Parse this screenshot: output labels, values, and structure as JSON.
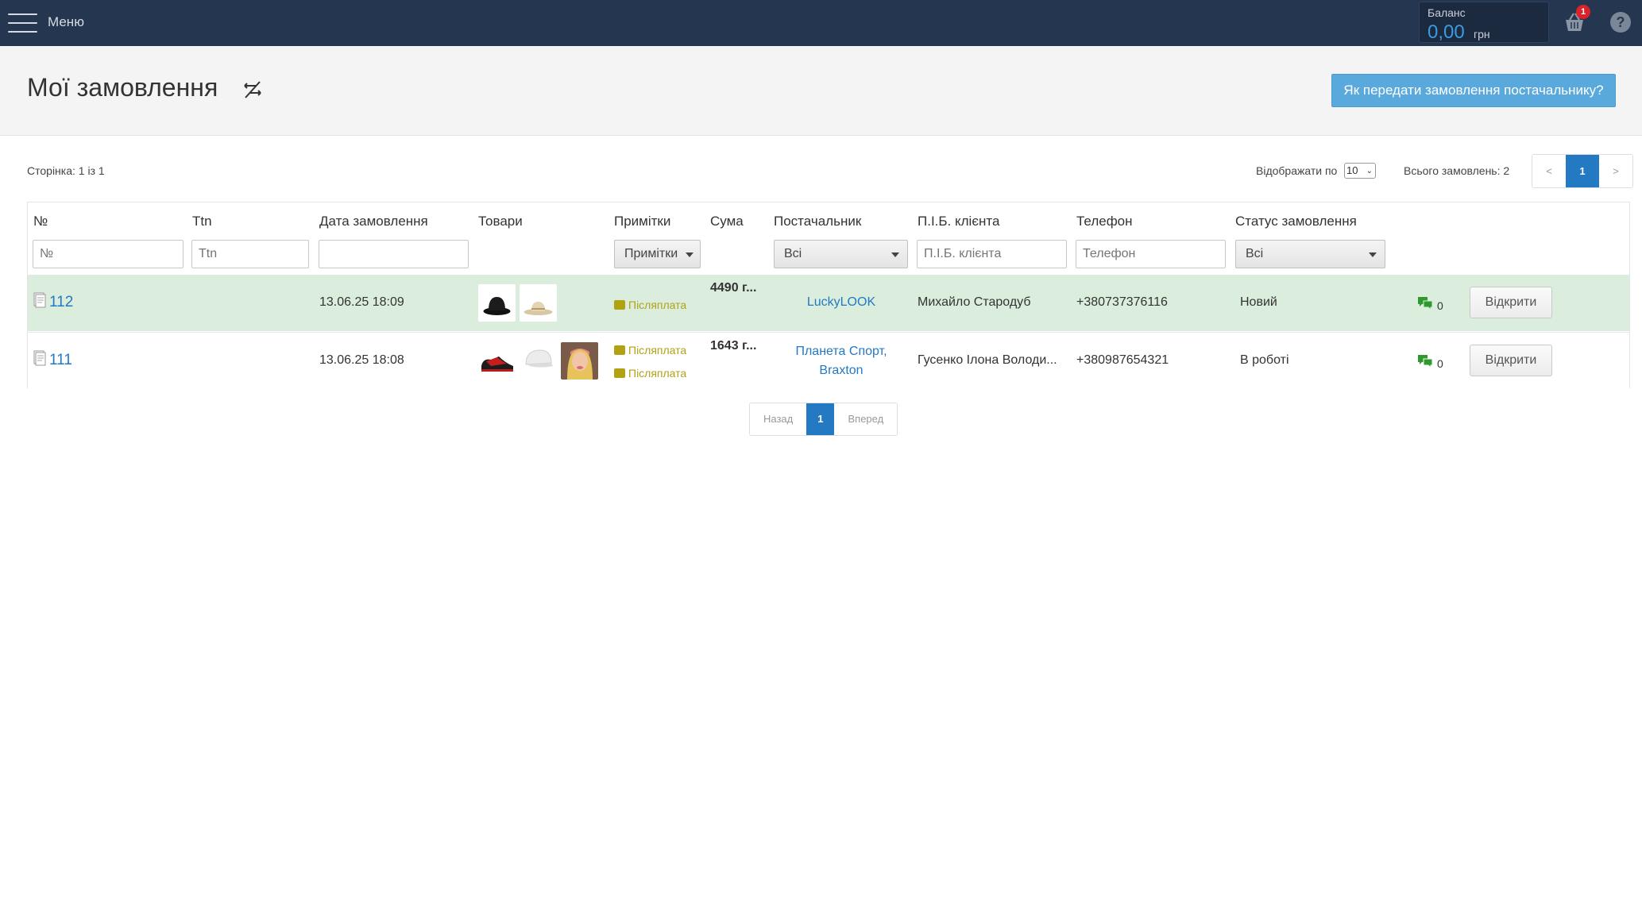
{
  "topbar": {
    "menu_label": "Меню",
    "balance_label": "Баланс",
    "balance_value": "0,00",
    "balance_currency": "грн",
    "cart_count": "1",
    "help_label": "?"
  },
  "header": {
    "title": "Мої замовлення",
    "howto_button": "Як передати замовлення постачальнику?"
  },
  "list_info": {
    "page_info": "Сторінка: 1 із 1",
    "show_by_label": "Відображати по",
    "show_by_value": "10",
    "total": "Всього замовлень: 2",
    "pager": {
      "prev": "<",
      "current": "1",
      "next": ">"
    }
  },
  "table": {
    "columns": {
      "number": "№",
      "ttn": "Ttn",
      "date": "Дата замовлення",
      "goods": "Товари",
      "notes": "Примітки",
      "sum": "Сума",
      "supplier": "Постачальник",
      "client": "П.І.Б. клієнта",
      "phone": "Телефон",
      "status": "Статус замовлення"
    },
    "filters": {
      "number_placeholder": "№",
      "ttn_placeholder": "Ttn",
      "date_value": "",
      "notes_select": "Примітки",
      "supplier_select": "Всі",
      "client_placeholder": "П.І.Б. клієнта",
      "phone_placeholder": "Телефон",
      "status_select": "Всі"
    },
    "rows": [
      {
        "number": "112",
        "ttn": "",
        "date": "13.06.25 18:09",
        "goods": [
          "black-hat",
          "beige-hat"
        ],
        "notes": [
          "Післяплата"
        ],
        "sum": "4490 г...",
        "supplier": [
          "LuckyLOOK"
        ],
        "client": "Михайло Стародуб",
        "phone": "+380737376116",
        "status": "Новий",
        "messages": "0",
        "open_button": "Відкрити",
        "highlight_color": "#dbeedd"
      },
      {
        "number": "111",
        "ttn": "",
        "date": "13.06.25 18:08",
        "goods": [
          "red-sneaker",
          "white-cap",
          "woman-photo"
        ],
        "notes": [
          "Післяплата",
          "Післяплата"
        ],
        "sum": "1643 г...",
        "supplier": [
          "Планета Спорт,",
          "Braxton"
        ],
        "client": "Гусенко Ілона Володи...",
        "phone": "+380987654321",
        "status": "В роботі",
        "messages": "0",
        "open_button": "Відкрити",
        "highlight_color": "#ffffff"
      }
    ]
  },
  "bottom_pager": {
    "prev": "Назад",
    "current": "1",
    "next": "Вперед"
  },
  "colors": {
    "topbar": "#253650",
    "accent": "#2479c3",
    "button": "#5aa9dc",
    "note": "#b2a113",
    "chat": "#2e9a2e",
    "badge": "#d8232a"
  }
}
